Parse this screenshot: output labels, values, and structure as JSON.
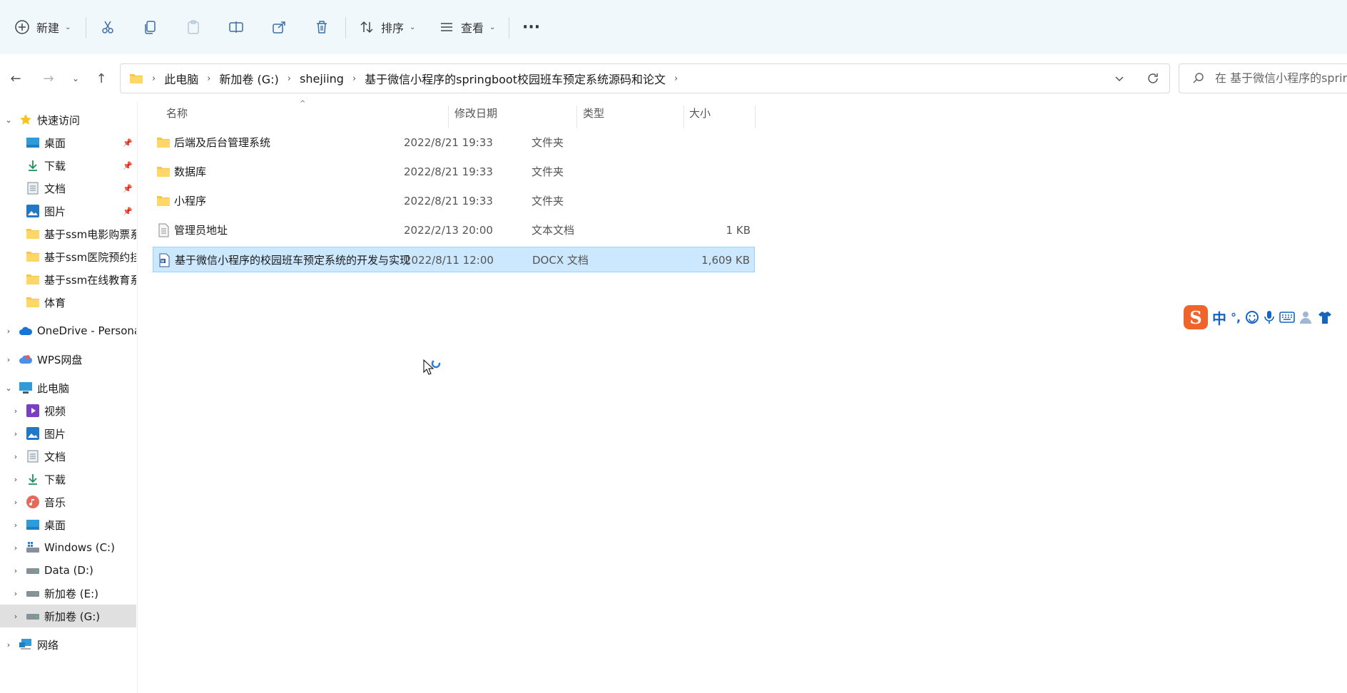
{
  "toolbar": {
    "new_label": "新建",
    "sort_label": "排序",
    "view_label": "查看",
    "more_label": "···"
  },
  "address": {
    "crumbs": [
      "此电脑",
      "新加卷 (G:)",
      "shejiing",
      "基于微信小程序的springboot校园班车预定系统源码和论文"
    ]
  },
  "search": {
    "placeholder": "在 基于微信小程序的spring"
  },
  "sidebar": {
    "quick_access": "快速访问",
    "quick_items": [
      "桌面",
      "下载",
      "文档",
      "图片",
      "基于ssm电影购票系",
      "基于ssm医院预约挂",
      "基于ssm在线教育系",
      "体育"
    ],
    "onedrive": "OneDrive - Persona",
    "wps": "WPS网盘",
    "this_pc": "此电脑",
    "pc_items": [
      "视频",
      "图片",
      "文档",
      "下载",
      "音乐",
      "桌面",
      "Windows (C:)",
      "Data (D:)",
      "新加卷 (E:)",
      "新加卷 (G:)"
    ],
    "network": "网络"
  },
  "columns": {
    "name": "名称",
    "date": "修改日期",
    "type": "类型",
    "size": "大小"
  },
  "files": [
    {
      "name": "后端及后台管理系统",
      "date": "2022/8/21 19:33",
      "type": "文件夹",
      "size": ""
    },
    {
      "name": "数据库",
      "date": "2022/8/21 19:33",
      "type": "文件夹",
      "size": ""
    },
    {
      "name": "小程序",
      "date": "2022/8/21 19:33",
      "type": "文件夹",
      "size": ""
    },
    {
      "name": "管理员地址",
      "date": "2022/2/13 20:00",
      "type": "文本文档",
      "size": "1 KB"
    },
    {
      "name": "基于微信小程序的校园班车预定系统的开发与实现",
      "date": "2022/8/11 12:00",
      "type": "DOCX 文档",
      "size": "1,609 KB"
    }
  ],
  "ime": {
    "mode": "中",
    "punct": "°,"
  }
}
